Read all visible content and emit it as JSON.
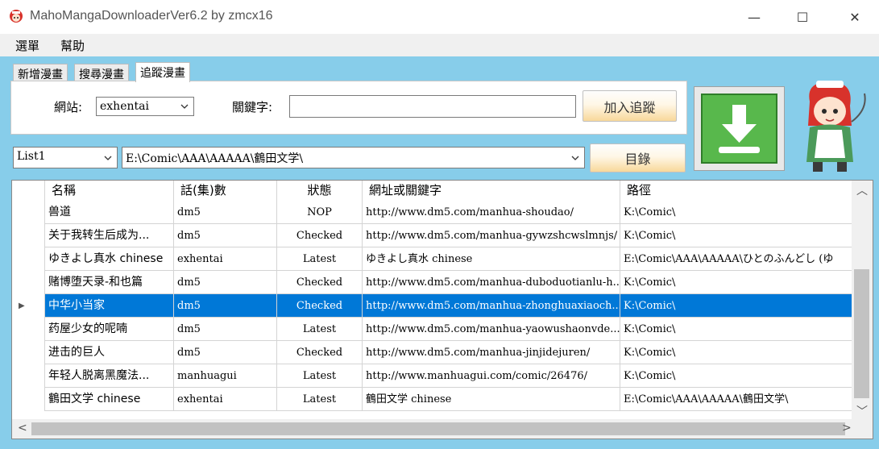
{
  "window": {
    "title": "MahoMangaDownloaderVer6.2 by zmcx16",
    "minimize": "—",
    "maximize": "☐",
    "close": "✕"
  },
  "menu": {
    "items": [
      "選單",
      "幫助"
    ]
  },
  "tabs": [
    {
      "label": "新增漫畫"
    },
    {
      "label": "搜尋漫畫"
    },
    {
      "label": "追蹤漫畫",
      "active": true
    }
  ],
  "panel": {
    "site_label": "網站:",
    "site_value": "exhentai",
    "keyword_label": "關鍵字:",
    "keyword_value": "",
    "add_track_label": "加入追蹤"
  },
  "list_select": {
    "value": "List1"
  },
  "path_select": {
    "value": "E:\\Comic\\AAA\\AAAAA\\鶴田文学\\"
  },
  "dir_button": {
    "label": "目錄"
  },
  "download_icon": "download-arrow-icon",
  "table": {
    "columns": [
      "名稱",
      "話(集)數",
      "狀態",
      "網址或關鍵字",
      "路徑"
    ],
    "rows": [
      [
        "兽道",
        "dm5",
        "NOP",
        "http://www.dm5.com/manhua-shoudao/",
        "K:\\Comic\\"
      ],
      [
        "关于我转生后成为...",
        "dm5",
        "Checked",
        "http://www.dm5.com/manhua-gywzshcwslmnjs/",
        "K:\\Comic\\"
      ],
      [
        "ゆきよし真水 chinese",
        "exhentai",
        "Latest",
        "ゆきよし真水 chinese",
        "E:\\Comic\\AAA\\AAAAA\\ひとのふんどし (ゆ"
      ],
      [
        "赌博堕天录-和也篇",
        "dm5",
        "Checked",
        "http://www.dm5.com/manhua-duboduotianlu-h...",
        "K:\\Comic\\"
      ],
      [
        "中华小当家",
        "dm5",
        "Checked",
        "http://www.dm5.com/manhua-zhonghuaxiaoch...",
        "K:\\Comic\\"
      ],
      [
        "药屋少女的呢喃",
        "dm5",
        "Latest",
        "http://www.dm5.com/manhua-yaowushaonvde...",
        "K:\\Comic\\"
      ],
      [
        "进击的巨人",
        "dm5",
        "Checked",
        "http://www.dm5.com/manhua-jinjidejuren/",
        "K:\\Comic\\"
      ],
      [
        "年轻人脱离黑魔法...",
        "manhuagui",
        "Latest",
        "http://www.manhuagui.com/comic/26476/",
        "K:\\Comic\\"
      ],
      [
        "鶴田文学 chinese",
        "exhentai",
        "Latest",
        "鶴田文学 chinese",
        "E:\\Comic\\AAA\\AAAAA\\鶴田文学\\"
      ]
    ],
    "selected_row_index": 4,
    "row_indicator": "▶"
  },
  "scroll": {
    "up": "︿",
    "down": "﹀",
    "left": "<",
    "right": ">"
  }
}
